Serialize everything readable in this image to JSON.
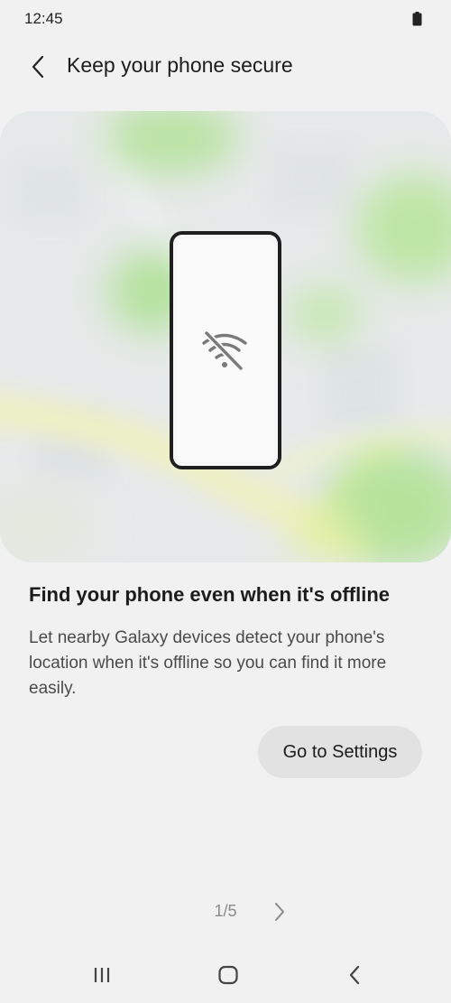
{
  "status_bar": {
    "time": "12:45",
    "battery_icon": "battery-icon"
  },
  "app_bar": {
    "back_icon": "chevron-left-icon",
    "title": "Keep your phone secure"
  },
  "hero": {
    "illustration": "phone-offline-on-map",
    "icon": "wifi-off-icon"
  },
  "content": {
    "headline": "Find your phone even when it's offline",
    "description": "Let nearby Galaxy devices detect your phone's location when it's offline so you can find it more easily.",
    "action_label": "Go to Settings"
  },
  "pager": {
    "indicator": "1/5",
    "next_icon": "chevron-right-icon"
  },
  "nav_bar": {
    "recents_icon": "recent-apps-icon",
    "home_icon": "home-icon",
    "back_icon": "back-icon"
  },
  "colors": {
    "background": "#f1f1f1",
    "button": "#e2e2e2",
    "map_green": "#b6e39a",
    "map_road": "#f2f3b8"
  }
}
